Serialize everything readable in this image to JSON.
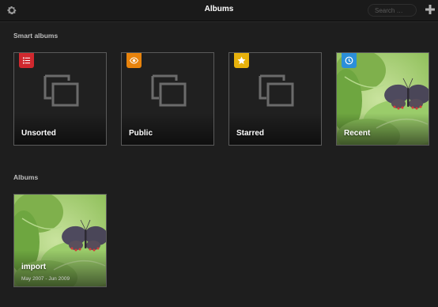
{
  "header": {
    "title": "Albums",
    "search_placeholder": "Search …",
    "settings_icon": "gear-icon",
    "add_icon": "plus-icon"
  },
  "smart_albums": {
    "heading": "Smart albums",
    "items": [
      {
        "label": "Unsorted",
        "badge_icon": "list-icon",
        "badge_color": "#d0282e"
      },
      {
        "label": "Public",
        "badge_icon": "eye-icon",
        "badge_color": "#e8830c"
      },
      {
        "label": "Starred",
        "badge_icon": "star-icon",
        "badge_color": "#e8b20c"
      },
      {
        "label": "Recent",
        "badge_icon": "clock-icon",
        "badge_color": "#2b8fd9"
      }
    ]
  },
  "albums": {
    "heading": "Albums",
    "items": [
      {
        "label": "import",
        "date_range": "May 2007 - Jun 2009"
      }
    ]
  }
}
